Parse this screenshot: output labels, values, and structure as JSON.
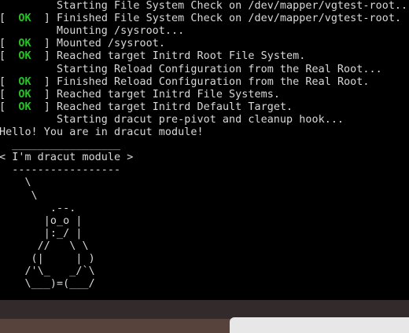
{
  "console": {
    "lines": [
      {
        "status": "",
        "text": "         Starting File System Check on /dev/mapper/vgtest-root..."
      },
      {
        "status": "  OK  ",
        "text": "Finished File System Check on /dev/mapper/vgtest-root."
      },
      {
        "status": "",
        "text": "         Mounting /sysroot..."
      },
      {
        "status": "  OK  ",
        "text": "Mounted /sysroot."
      },
      {
        "status": "  OK  ",
        "text": "Reached target Initrd Root File System."
      },
      {
        "status": "",
        "text": "         Starting Reload Configuration from the Real Root..."
      },
      {
        "status": "  OK  ",
        "text": "Finished Reload Configuration from the Real Root."
      },
      {
        "status": "  OK  ",
        "text": "Reached target Initrd File Systems."
      },
      {
        "status": "  OK  ",
        "text": "Reached target Initrd Default Target."
      },
      {
        "status": "",
        "text": "         Starting dracut pre-pivot and cleanup hook..."
      },
      {
        "status": "",
        "text": "Hello! You are in dracut module!"
      },
      {
        "status": "",
        "text": "  _________________"
      },
      {
        "status": "",
        "text": "< I'm dracut module >"
      },
      {
        "status": "",
        "text": "  -----------------"
      },
      {
        "status": "",
        "text": "    \\"
      },
      {
        "status": "",
        "text": "     \\"
      },
      {
        "status": "",
        "text": "        .--."
      },
      {
        "status": "",
        "text": "       |o_o |"
      },
      {
        "status": "",
        "text": "       |:_/ |"
      },
      {
        "status": "",
        "text": "      //   \\ \\"
      },
      {
        "status": "",
        "text": "     (|     | )"
      },
      {
        "status": "",
        "text": "    /'\\_   _/`\\"
      },
      {
        "status": "",
        "text": "    \\___)=(___/"
      }
    ]
  }
}
